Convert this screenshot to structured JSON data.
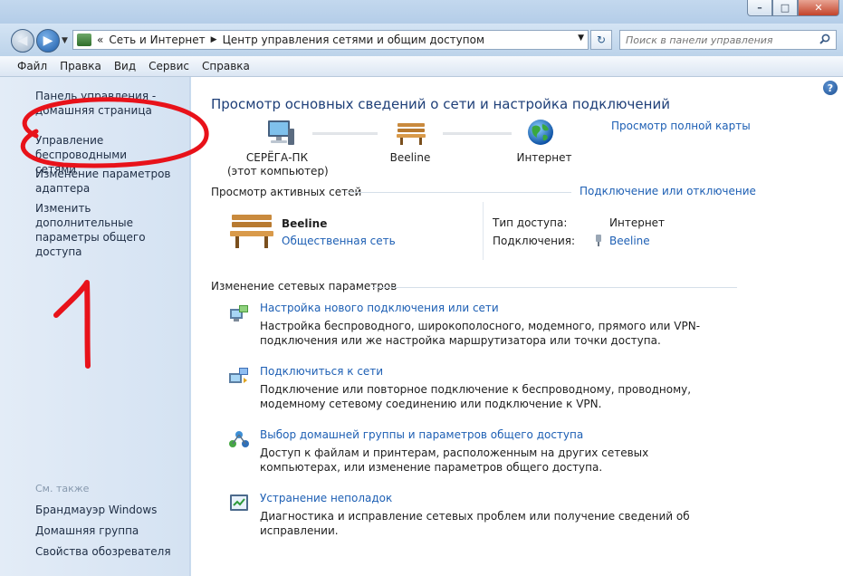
{
  "window": {
    "minimize_glyph": "–",
    "maximize_glyph": "□",
    "close_glyph": "✕"
  },
  "navigation": {
    "back_glyph": "◀",
    "forward_glyph": "▶",
    "breadcrumb_lead": "«",
    "address_parts": [
      "Сеть и Интернет",
      "Центр управления сетями и общим доступом"
    ],
    "breadcrumb_sep": "▶",
    "refresh_glyph": "↻",
    "search_placeholder": "Поиск в панели управления"
  },
  "menubar": {
    "items": [
      "Файл",
      "Правка",
      "Вид",
      "Сервис",
      "Справка"
    ]
  },
  "sidebar": {
    "links": [
      {
        "label": "Панель управления -\nдомашняя страница"
      },
      {
        "label": "Управление беспроводными\nсетями"
      },
      {
        "label": "Изменение параметров\nадаптера"
      },
      {
        "label": "Изменить дополнительные\nпараметры общего доступа"
      }
    ],
    "see_also_title": "См. также",
    "see_also": [
      "Брандмауэр Windows",
      "Домашняя группа",
      "Свойства обозревателя"
    ]
  },
  "annotation": {
    "number": "1",
    "color": "#e8121a"
  },
  "main": {
    "help_glyph": "?",
    "title": "Просмотр основных сведений о сети и настройка подключений",
    "full_map_link": "Просмотр полной карты",
    "map": {
      "computer_name": "СЕРЁГА-ПК",
      "computer_sub": "(этот компьютер)",
      "network_name": "Beeline",
      "internet_name": "Интернет"
    },
    "active_networks": {
      "heading": "Просмотр активных сетей",
      "connect_link": "Подключение или отключение",
      "network_name": "Beeline",
      "network_type": "Общественная сеть",
      "access_type_label": "Тип доступа:",
      "access_type_value": "Интернет",
      "connections_label": "Подключения:",
      "connections_value": "Beeline"
    },
    "change_settings": {
      "heading": "Изменение сетевых параметров",
      "tasks": [
        {
          "title": "Настройка нового подключения или сети",
          "desc": "Настройка беспроводного, широкополосного, модемного, прямого или VPN-подключения или же настройка маршрутизатора или точки доступа."
        },
        {
          "title": "Подключиться к сети",
          "desc": "Подключение или повторное подключение к беспроводному, проводному, модемному сетевому соединению или подключение к VPN."
        },
        {
          "title": "Выбор домашней группы и параметров общего доступа",
          "desc": "Доступ к файлам и принтерам, расположенным на других сетевых компьютерах, или изменение параметров общего доступа."
        },
        {
          "title": "Устранение неполадок",
          "desc": "Диагностика и исправление сетевых проблем или получение сведений об исправлении."
        }
      ]
    }
  }
}
